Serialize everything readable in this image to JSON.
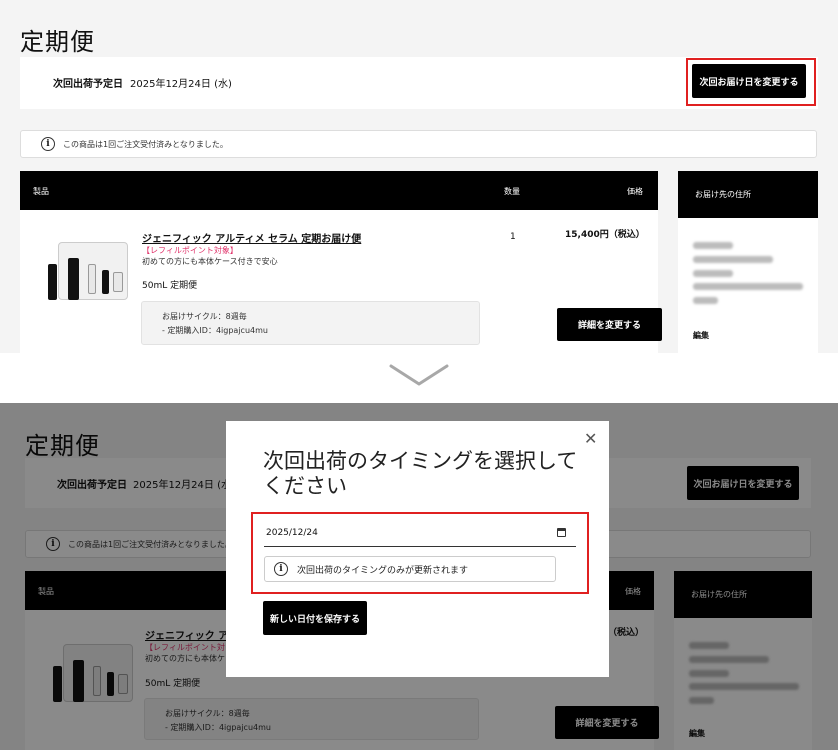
{
  "page": {
    "title": "定期便",
    "ship_label": "次回出荷予定日",
    "ship_date": "2025年12月24日 (水)",
    "change_date_button": "次回お届け日を変更する",
    "notice": "この商品は1回ご注文受付済みとなりました。"
  },
  "table": {
    "col_product": "製品",
    "col_qty": "数量",
    "col_price": "価格",
    "product_name": "ジェニフィック アルティメ セラム 定期お届け便",
    "refill_tag": "【レフィルポイント対象】",
    "product_sub": "初めての方にも本体ケース付きで安心",
    "volume": "50mL 定期便",
    "qty": "1",
    "price": "15,400円（税込）",
    "cycle": "お届けサイクル：8週毎",
    "purchase_id": "- 定期購入ID：4igpajcu4mu",
    "details_button": "詳細を変更する"
  },
  "address": {
    "heading": "お届け先の住所",
    "edit": "編集"
  },
  "modal": {
    "title": "次回出荷のタイミングを選択してください",
    "date_value": "2025/12/24",
    "note": "次回出荷のタイミングのみが更新されます",
    "save_button": "新しい日付を保存する",
    "close": "✕"
  },
  "bottom": {
    "price_partial": "（税込）",
    "product_name_partial": "ジェニフィック ア",
    "refill_partial": "【レフィルポイント対",
    "sub_partial": "初めての方にも本体ケ"
  },
  "icons": {
    "info": "info-icon",
    "chevron": "chevron-down-icon",
    "close": "close-icon",
    "calendar": "calendar-icon"
  },
  "colors": {
    "accent_red": "#e02020",
    "refill_pink": "#e0336b",
    "black": "#000000"
  }
}
